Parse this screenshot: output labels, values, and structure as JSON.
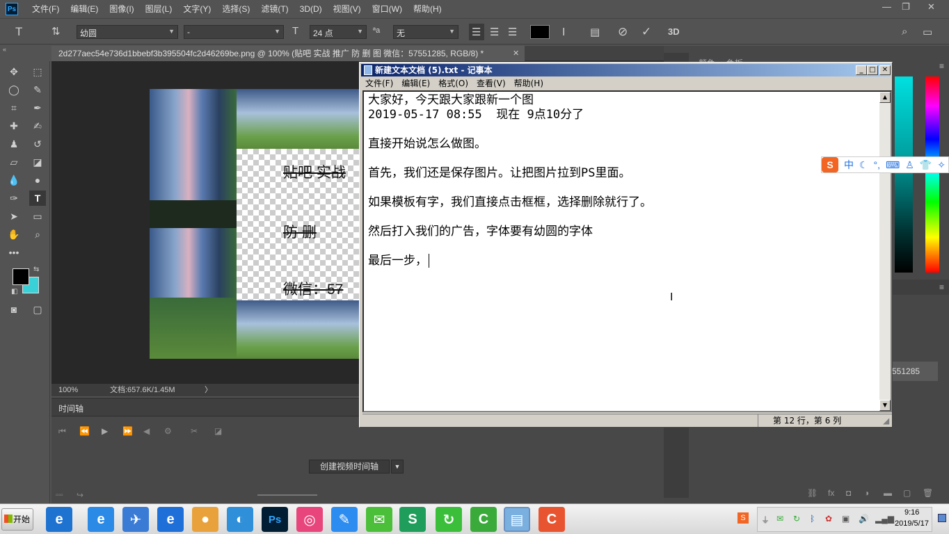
{
  "photoshop": {
    "logo": "Ps",
    "menu": [
      "文件(F)",
      "编辑(E)",
      "图像(I)",
      "图层(L)",
      "文字(Y)",
      "选择(S)",
      "滤镜(T)",
      "3D(D)",
      "视图(V)",
      "窗口(W)",
      "帮助(H)"
    ],
    "options": {
      "font_family": "幼圆",
      "font_style": "-",
      "font_size": "24 点",
      "aa_label": "ªa",
      "antialias": "无",
      "threed_label": "3D"
    },
    "document_tab": "2d277aec54e736d1bbebf3b395504fc2d46269be.png @ 100% (贴吧 实战  推广 防  删   图 微信：57551285, RGB/8) *",
    "canvas_texts": [
      "贴吧  实战",
      "防    删",
      "微信：57"
    ],
    "status": {
      "zoom": "100%",
      "doc": "文档:657.6K/1.45M"
    },
    "timeline": {
      "title": "时间轴",
      "create_button": "创建视频时间轴"
    },
    "right_panel": {
      "tab1": "颜色",
      "tab2": "色板",
      "layer_snippet": "551285"
    }
  },
  "notepad": {
    "title": "新建文本文档 (5).txt - 记事本",
    "menu": [
      "文件(F)",
      "编辑(E)",
      "格式(O)",
      "查看(V)",
      "帮助(H)"
    ],
    "lines": [
      "大家好，今天跟大家跟新一个图",
      "2019-05-17 08:55  现在 9点10分了",
      "",
      "直接开始说怎么做图。",
      "",
      "首先，我们还是保存图片。让把图片拉到PS里面。",
      "",
      "如果模板有字，我们直接点击框框，选择删除就行了。",
      "",
      "然后打入我们的广告，字体要有幼圆的字体",
      "",
      "最后一步，"
    ],
    "status": "第 12 行，第 6 列"
  },
  "ime": {
    "logo": "S",
    "mode": "中"
  },
  "taskbar": {
    "start": "开始",
    "apps": [
      {
        "icon": "ie-icon",
        "glyph": "e",
        "color": "#1e73d0"
      },
      {
        "icon": "ie-icon-2",
        "glyph": "e",
        "color": "#2a8ae6"
      },
      {
        "icon": "feishu-icon",
        "glyph": "✈",
        "color": "#3a7bd5"
      },
      {
        "icon": "edge-icon",
        "glyph": "e",
        "color": "#1f6fd8"
      },
      {
        "icon": "browser-icon",
        "glyph": "●",
        "color": "#e9a23b"
      },
      {
        "icon": "search-app-icon",
        "glyph": "◐",
        "color": "#2f8fd8"
      },
      {
        "icon": "photoshop-icon",
        "glyph": "Ps",
        "color": "#001d34"
      },
      {
        "icon": "meitu-icon",
        "glyph": "◎",
        "color": "#e8457c"
      },
      {
        "icon": "pen-app-icon",
        "glyph": "✎",
        "color": "#2d8cf0"
      },
      {
        "icon": "wechat-icon",
        "glyph": "✉",
        "color": "#4cbf3a"
      },
      {
        "icon": "sogou-app-icon",
        "glyph": "S",
        "color": "#1e9e5a"
      },
      {
        "icon": "refresh-app-icon",
        "glyph": "↻",
        "color": "#3bbf3b"
      },
      {
        "icon": "camtasia-icon",
        "glyph": "C",
        "color": "#3aaa3a"
      },
      {
        "icon": "notepad-icon",
        "glyph": "▤",
        "color": "#7ab0e0"
      },
      {
        "icon": "record-icon",
        "glyph": "C",
        "color": "#e8542f"
      }
    ],
    "clock": {
      "time": "9:16",
      "date": "2019/5/17"
    }
  }
}
